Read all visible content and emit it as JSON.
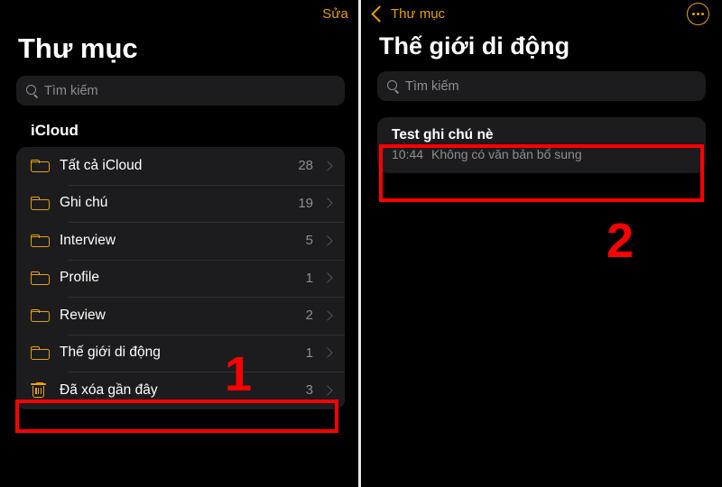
{
  "left_panel": {
    "topbar": {
      "edit_label": "Sửa"
    },
    "title": "Thư mục",
    "search": {
      "placeholder": "Tìm kiếm",
      "icon": "search-icon"
    },
    "section_header": "iCloud",
    "rows": [
      {
        "icon": "folder-icon",
        "label": "Tất cả iCloud",
        "count": "28",
        "chevron": "chevron-right-icon"
      },
      {
        "icon": "folder-icon",
        "label": "Ghi chú",
        "count": "19",
        "chevron": "chevron-right-icon"
      },
      {
        "icon": "folder-icon",
        "label": "Interview",
        "count": "5",
        "chevron": "chevron-right-icon"
      },
      {
        "icon": "folder-icon",
        "label": "Profile",
        "count": "1",
        "chevron": "chevron-right-icon"
      },
      {
        "icon": "folder-icon",
        "label": "Review",
        "count": "2",
        "chevron": "chevron-right-icon"
      },
      {
        "icon": "folder-icon",
        "label": "Thế giới di động",
        "count": "1",
        "chevron": "chevron-right-icon"
      },
      {
        "icon": "trash-icon",
        "label": "Đã xóa gần đây",
        "count": "3",
        "chevron": "chevron-right-icon"
      }
    ]
  },
  "right_panel": {
    "topbar": {
      "back_label": "Thư mục",
      "back_icon": "chevron-left-icon",
      "more_icon": "more-circle-icon"
    },
    "title": "Thế giới di động",
    "search": {
      "placeholder": "Tìm kiếm",
      "icon": "search-icon"
    },
    "notes": [
      {
        "title": "Test ghi chú nè",
        "time": "10:44",
        "snippet": "Không có văn bản bổ sung"
      }
    ]
  },
  "annotations": {
    "step_one": "1",
    "step_two": "2",
    "color": "#ff0000"
  },
  "theme": {
    "background": "#000000",
    "card": "#1c1c1e",
    "accent": "#e5a00d",
    "text_primary": "#ffffff",
    "text_secondary": "#8d8d93"
  }
}
